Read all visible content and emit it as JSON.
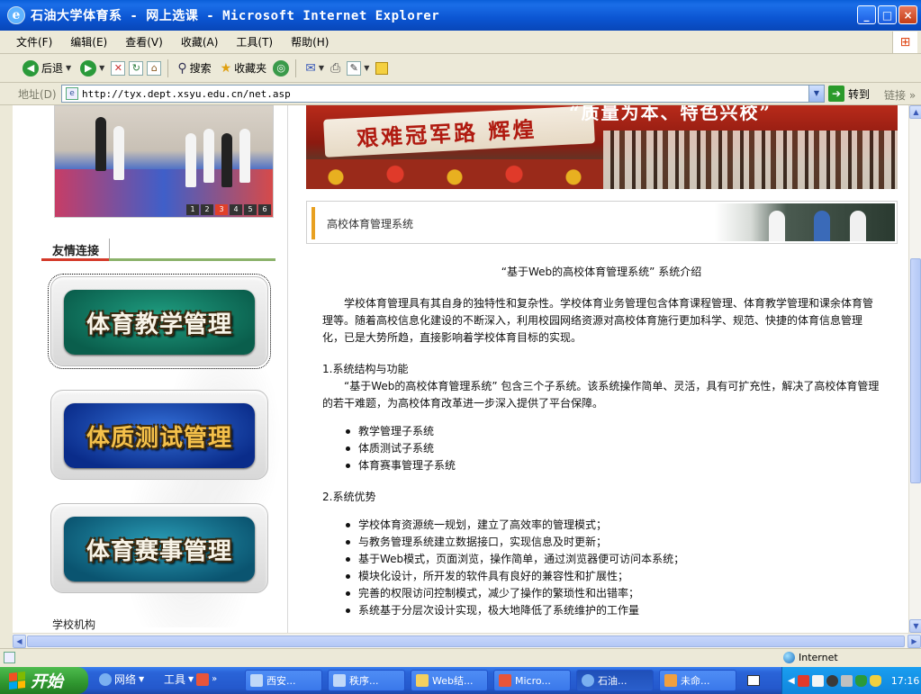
{
  "window": {
    "title": "石油大学体育系 - 网上选课 - Microsoft Internet Explorer",
    "buttons": {
      "minimize": "_",
      "maximize": "□",
      "close": "×"
    }
  },
  "menu": [
    "文件(F)",
    "编辑(E)",
    "查看(V)",
    "收藏(A)",
    "工具(T)",
    "帮助(H)"
  ],
  "toolbar": {
    "back": "后退",
    "search": "搜索",
    "favorites": "收藏夹"
  },
  "address": {
    "label": "地址(D)",
    "url": "http://tyx.dept.xsyu.edu.cn/net.asp",
    "go": "转到",
    "links": "链接"
  },
  "page": {
    "slideshow_pages": [
      "1",
      "2",
      "3",
      "4",
      "5",
      "6"
    ],
    "slideshow_active": 3,
    "friend_links_title": "友情连接",
    "banners": [
      "体育教学管理",
      "体质测试管理",
      "体育赛事管理"
    ],
    "org_label": "学校机构",
    "hero_text": "艰难冠军路  辉煌",
    "hero_slogan": "“质量为本、特色兴校”",
    "section_title": "高校体育管理系统",
    "article": {
      "title": "“基于Web的高校体育管理系统” 系统介绍",
      "intro": "学校体育管理具有其自身的独特性和复杂性。学校体育业务管理包含体育课程管理、体育教学管理和课余体育管理等。随着高校信息化建设的不断深入，利用校园网络资源对高校体育施行更加科学、规范、快捷的体育信息管理化，已是大势所趋，直接影响着学校体育目标的实现。",
      "s1_heading": "1.系统结构与功能",
      "s1_body": "“基于Web的高校体育管理系统” 包含三个子系统。该系统操作简单、灵活，具有可扩充性，解决了高校体育管理的若干难题，为高校体育改革进一步深入提供了平台保障。",
      "s1_items": [
        "教学管理子系统",
        "体质测试子系统",
        "体育赛事管理子系统"
      ],
      "s2_heading": "2.系统优势",
      "s2_items": [
        "学校体育资源统一规划，建立了高效率的管理模式；",
        "与教务管理系统建立数据接口，实现信息及时更新；",
        "基于Web模式，页面浏览，操作简单，通过浏览器便可访问本系统；",
        "模块化设计，所开发的软件具有良好的兼容性和扩展性；",
        "完善的权限访问控制模式，减少了操作的繁琐性和出错率；",
        "系统基于分层次设计实现，极大地降低了系统维护的工作量"
      ]
    }
  },
  "status": {
    "zone": "Internet"
  },
  "taskbar": {
    "start": "开始",
    "quick": [
      "网络",
      "工具"
    ],
    "tasks": [
      "西安...",
      "秩序...",
      "Web结...",
      "Micro...",
      "石油...",
      "未命..."
    ],
    "clock": "17:16"
  },
  "colors": {
    "title_bar": "#0b55d2",
    "taskbar": "#2458cc",
    "start": "#2f962f",
    "accent_orange": "#e8a020"
  }
}
